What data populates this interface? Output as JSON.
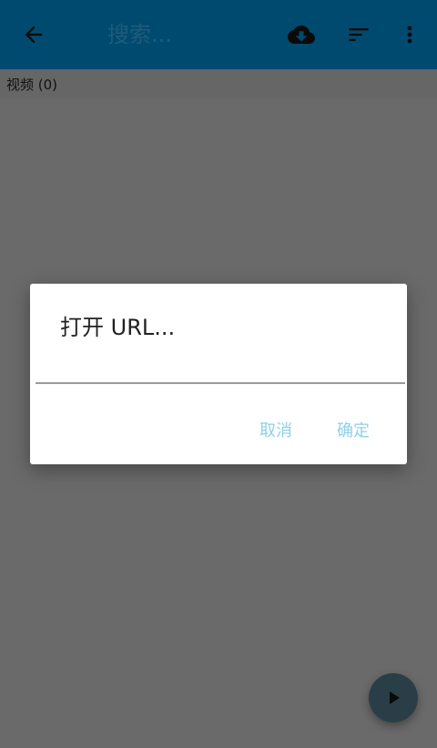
{
  "toolbar": {
    "search_placeholder": "搜索...",
    "back_icon": "arrow-back-icon",
    "cloud_icon": "cloud-download-icon",
    "sort_icon": "sort-icon",
    "more_icon": "more-vert-icon"
  },
  "list": {
    "section_label": "视频 (0)"
  },
  "dialog": {
    "title": "打开 URL...",
    "url_value": "",
    "cancel_label": "取消",
    "ok_label": "确定"
  },
  "fab": {
    "icon": "play-icon"
  },
  "colors": {
    "appbar": "#004a70",
    "scrim": "#6a6a6a",
    "dialog_button": "#8fd0ea",
    "fab": "#2a3e48"
  }
}
